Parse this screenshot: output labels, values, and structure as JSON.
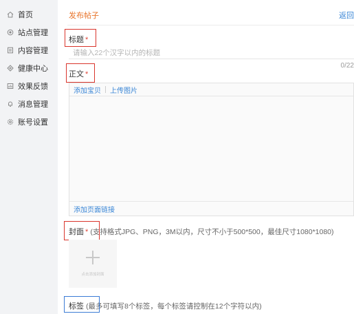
{
  "sidebar": {
    "items": [
      {
        "label": "首页",
        "icon": "home-icon"
      },
      {
        "label": "站点管理",
        "icon": "globe-icon"
      },
      {
        "label": "内容管理",
        "icon": "document-icon"
      },
      {
        "label": "健康中心",
        "icon": "shield-icon"
      },
      {
        "label": "效果反馈",
        "icon": "chart-icon"
      },
      {
        "label": "消息管理",
        "icon": "bell-icon"
      },
      {
        "label": "账号设置",
        "icon": "gear-icon"
      }
    ]
  },
  "header": {
    "title": "发布帖子",
    "back_label": "返回"
  },
  "form": {
    "title_label": "标题",
    "title_placeholder": "请输入22个汉字以内的标题",
    "required_mark": "*",
    "counter": "0/22",
    "body_label": "正文",
    "toolbar": {
      "add_link": "添加宝贝",
      "upload_image": "上传图片"
    },
    "footer_link": "添加页面链接",
    "cover_label": "封面",
    "cover_hint": "(支持格式JPG、PNG，3M以内，尺寸不小于500*500，最佳尺寸1080*1080)",
    "cover_caption": "点击添加封面",
    "tags_label": "标签",
    "tags_hint": "(最多可填写8个标签，每个标签请控制在12个字符以内)"
  },
  "colors": {
    "accent": "#e8742a",
    "link": "#3a86d6",
    "required": "#e0473a",
    "highlight_red": "#d9342b",
    "highlight_blue": "#3a7bd5"
  }
}
